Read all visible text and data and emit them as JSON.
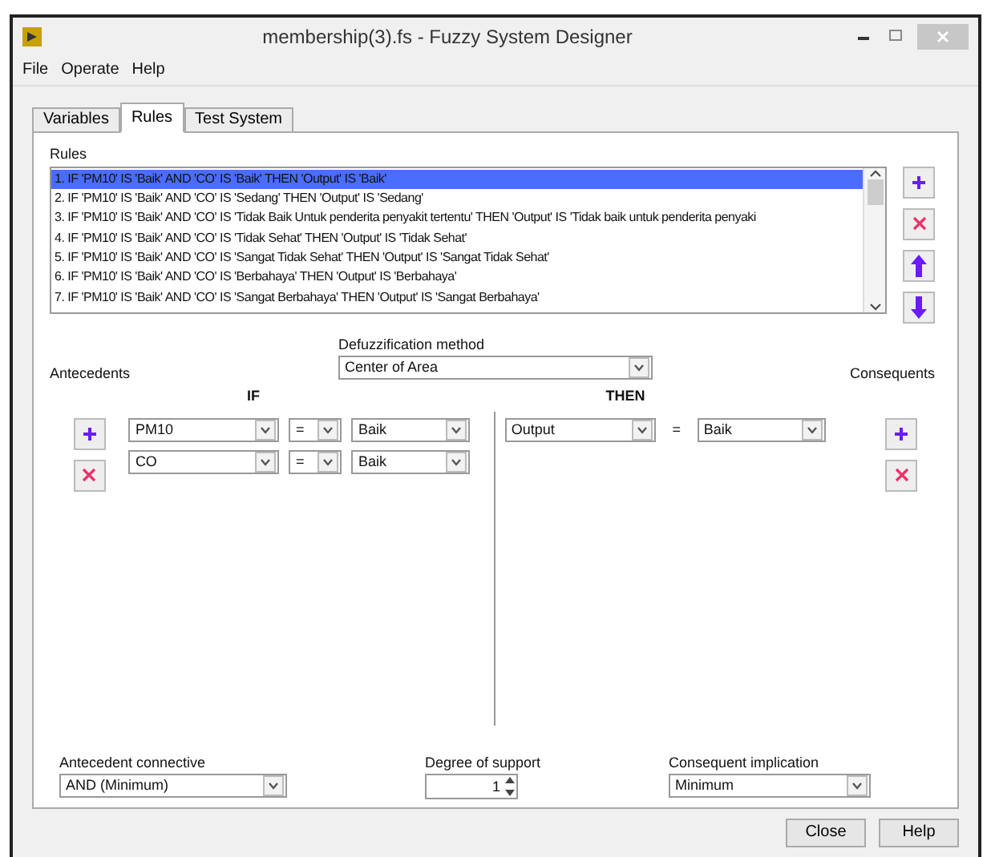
{
  "window": {
    "title": "membership(3).fs - Fuzzy System Designer"
  },
  "menu": [
    "File",
    "Operate",
    "Help"
  ],
  "tabs": [
    {
      "label": "Variables",
      "selected": false
    },
    {
      "label": "Rules",
      "selected": true
    },
    {
      "label": "Test System",
      "selected": false
    }
  ],
  "rules": {
    "label": "Rules",
    "items": [
      {
        "text": "1. IF 'PM10' IS 'Baik' AND 'CO' IS 'Baik' THEN 'Output' IS 'Baik'",
        "selected": true
      },
      {
        "text": "2. IF 'PM10' IS 'Baik' AND 'CO' IS 'Sedang' THEN 'Output' IS 'Sedang'",
        "selected": false
      },
      {
        "text": "3. IF 'PM10' IS 'Baik' AND 'CO' IS 'Tidak Baik Untuk penderita penyakit tertentu' THEN 'Output' IS 'Tidak baik untuk penderita penyaki",
        "selected": false
      },
      {
        "text": "4. IF 'PM10' IS 'Baik' AND 'CO' IS 'Tidak Sehat' THEN 'Output' IS 'Tidak Sehat'",
        "selected": false
      },
      {
        "text": "5. IF 'PM10' IS 'Baik' AND 'CO' IS 'Sangat Tidak Sehat' THEN 'Output' IS 'Sangat Tidak Sehat'",
        "selected": false
      },
      {
        "text": "6. IF 'PM10' IS 'Baik' AND 'CO' IS 'Berbahaya' THEN 'Output' IS 'Berbahaya'",
        "selected": false
      },
      {
        "text": "7. IF 'PM10' IS 'Baik' AND 'CO' IS 'Sangat Berbahaya' THEN 'Output' IS 'Sangat Berbahaya'",
        "selected": false
      }
    ]
  },
  "defuzzification": {
    "label": "Defuzzification method",
    "value": "Center of Area"
  },
  "antecedents_label": "Antecedents",
  "consequents_label": "Consequents",
  "if_label": "IF",
  "then_label": "THEN",
  "antecedents": [
    {
      "variable": "PM10",
      "operator": "=",
      "term": "Baik"
    },
    {
      "variable": "CO",
      "operator": "=",
      "term": "Baik"
    }
  ],
  "consequents": [
    {
      "variable": "Output",
      "operator": "=",
      "term": "Baik"
    }
  ],
  "connective": {
    "label": "Antecedent connective",
    "value": "AND (Minimum)"
  },
  "support": {
    "label": "Degree of support",
    "value": "1"
  },
  "implication": {
    "label": "Consequent implication",
    "value": "Minimum"
  },
  "buttons": [
    "Close",
    "Help"
  ]
}
